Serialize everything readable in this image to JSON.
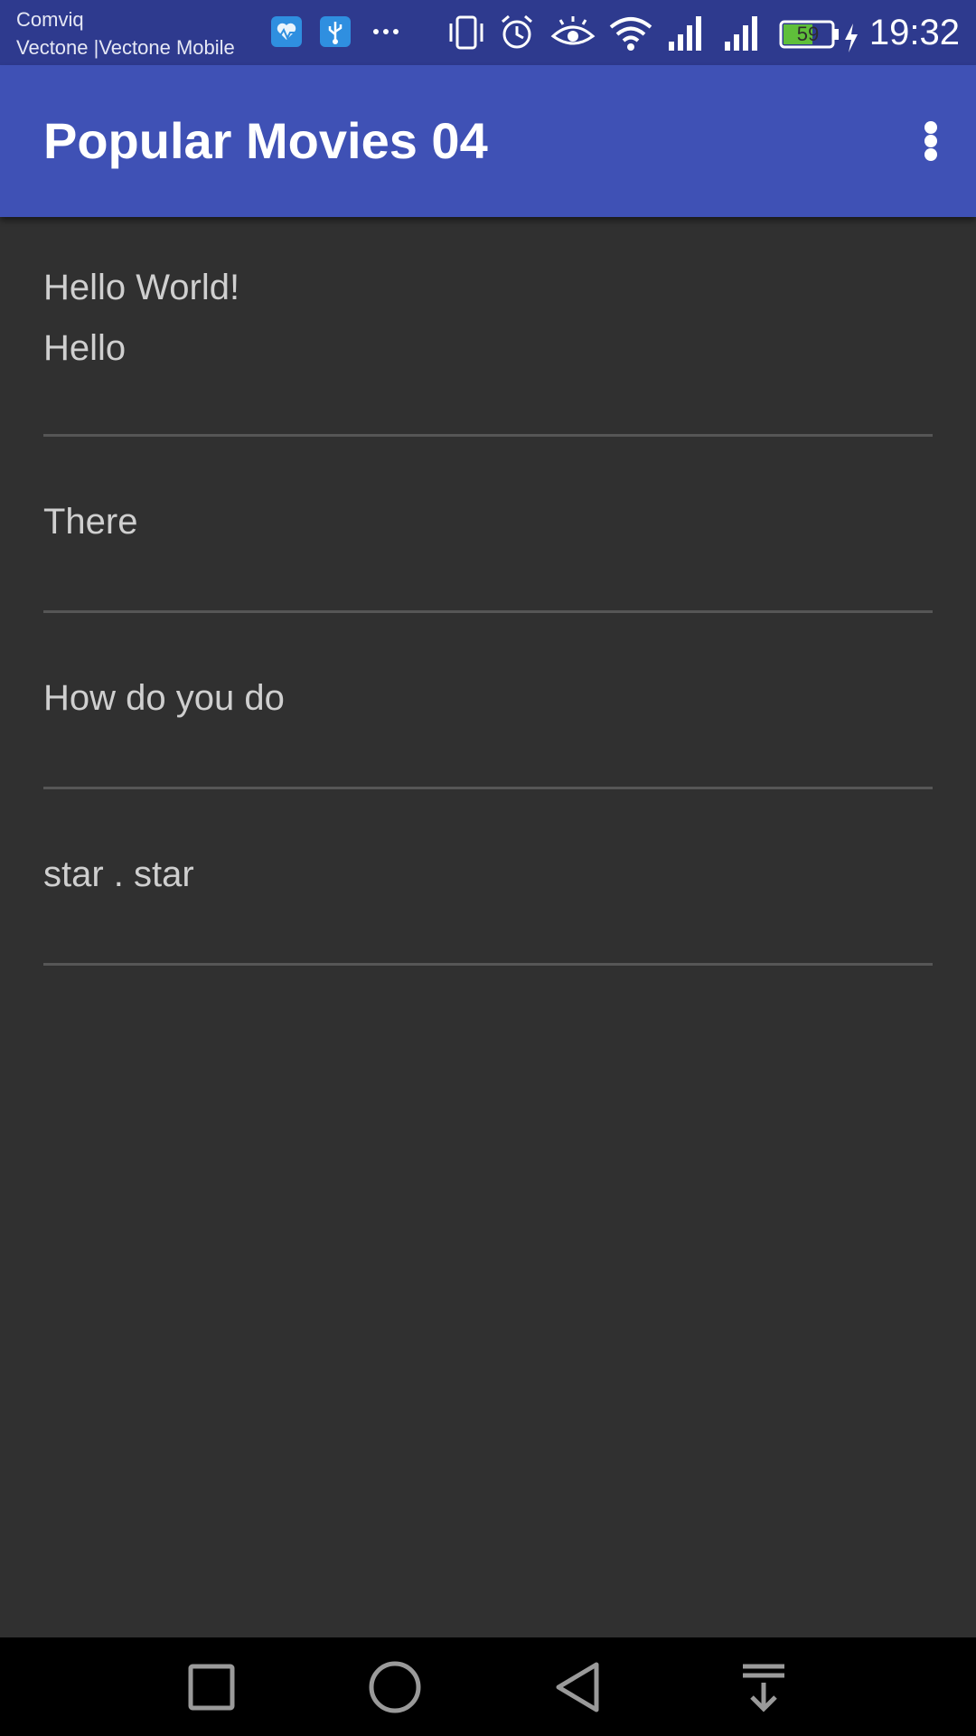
{
  "status_bar": {
    "carrier_line_1": "Comviq",
    "carrier_line_2": "Vectone |Vectone Mobile",
    "battery_level": "59",
    "time": "19:32",
    "notification_icons": [
      "health-icon",
      "usb-icon",
      "more-notifications-icon"
    ],
    "system_icons": [
      "vibrate-icon",
      "alarm-icon",
      "eye-comfort-icon",
      "wifi-icon",
      "signal-icon",
      "signal-icon",
      "battery-icon",
      "charging-icon"
    ]
  },
  "app_bar": {
    "title": "Popular Movies 04",
    "overflow_icon": "more-vert-icon",
    "color": "#3f51b5"
  },
  "list": {
    "items": [
      {
        "lines": [
          "Hello World!",
          "Hello"
        ]
      },
      {
        "lines": [
          "There"
        ]
      },
      {
        "lines": [
          "How do you do"
        ]
      },
      {
        "lines": [
          "star . star"
        ]
      }
    ]
  },
  "nav_bar": {
    "buttons": [
      "recent-apps-icon",
      "home-icon",
      "back-icon",
      "notification-pull-icon"
    ]
  },
  "colors": {
    "status_bar": "#2e3a8e",
    "app_bar": "#3f51b5",
    "background": "#303030",
    "text": "#cfcfcf",
    "divider": "#565656",
    "battery_fill": "#5fbf3a"
  }
}
